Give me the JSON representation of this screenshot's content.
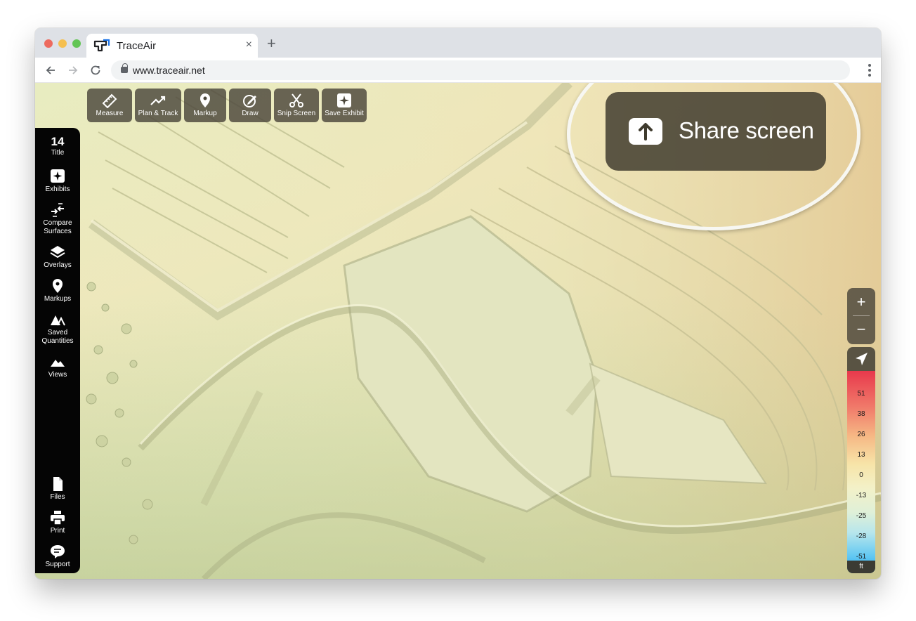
{
  "browser": {
    "tab_title": "TraceAir",
    "tab_close": "×",
    "new_tab": "+",
    "url": "www.traceair.net"
  },
  "tools": [
    {
      "label": "Measure",
      "icon": "ruler-icon"
    },
    {
      "label": "Plan & Track",
      "icon": "trend-icon"
    },
    {
      "label": "Markup",
      "icon": "map-pin-icon"
    },
    {
      "label": "Draw",
      "icon": "pencil-icon"
    },
    {
      "label": "Snip Screen",
      "icon": "scissors-icon"
    },
    {
      "label": "Save Exhibit",
      "icon": "sparkle-icon"
    }
  ],
  "sidebar": {
    "day": {
      "number": "14",
      "label": "Title"
    },
    "items": [
      {
        "label": "Exhibits",
        "icon": "sparkle-icon"
      },
      {
        "label": "Compare Surfaces",
        "icon": "compare-arrows-icon"
      },
      {
        "label": "Overlays",
        "icon": "layers-icon"
      },
      {
        "label": "Markups",
        "icon": "map-pin-icon"
      },
      {
        "label": "Saved Quantities",
        "icon": "mountain-outline-icon"
      },
      {
        "label": "Views",
        "icon": "mountain-icon"
      }
    ],
    "bottom": [
      {
        "label": "Files",
        "icon": "file-icon"
      },
      {
        "label": "Print",
        "icon": "printer-icon"
      },
      {
        "label": "Support",
        "icon": "chat-icon"
      }
    ]
  },
  "share": {
    "label": "Share screen",
    "icon": "upload-arrow-icon"
  },
  "zoom": {
    "in": "+",
    "out": "−"
  },
  "legend": {
    "values": [
      "51",
      "38",
      "26",
      "13",
      "0",
      "-13",
      "-25",
      "-28",
      "-51"
    ],
    "unit": "ft"
  },
  "colors": {
    "sidebar_bg": "#050505",
    "tool_bg": "#4a463a",
    "legend_top": "#e8394c",
    "legend_bottom": "#22a5f5"
  }
}
